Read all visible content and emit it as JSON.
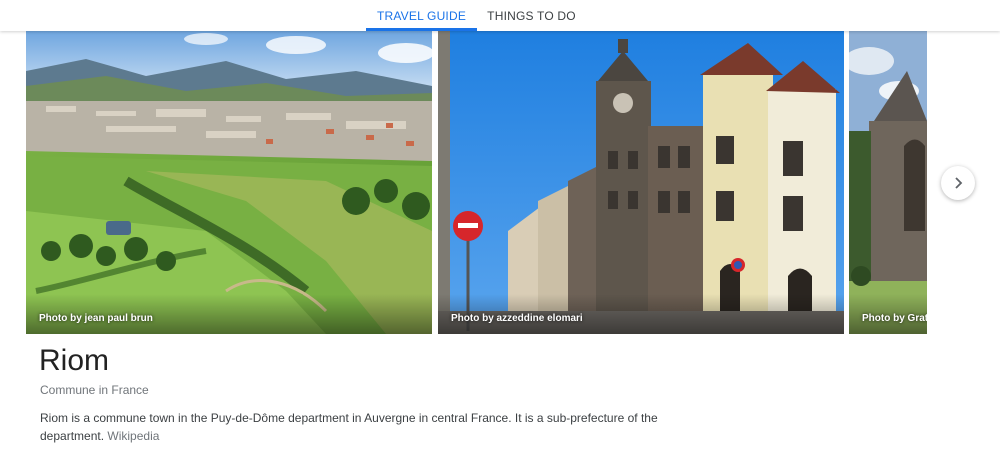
{
  "tabs": [
    {
      "label": "TRAVEL GUIDE",
      "active": true
    },
    {
      "label": "THINGS TO DO",
      "active": false
    }
  ],
  "photos": [
    {
      "credit": "Photo by jean paul brun"
    },
    {
      "credit": "Photo by azzeddine elomari"
    },
    {
      "credit": "Photo by Grati"
    }
  ],
  "carousel": {
    "next_icon": "chevron-right-icon"
  },
  "place": {
    "title": "Riom",
    "subtitle": "Commune in France",
    "description": "Riom is a commune town in the Puy-de-Dôme department in Auvergne in central France. It is a sub-prefecture of the department.",
    "source": "Wikipedia"
  },
  "colors": {
    "active_tab": "#1a73e8",
    "text_secondary": "#70757a"
  }
}
